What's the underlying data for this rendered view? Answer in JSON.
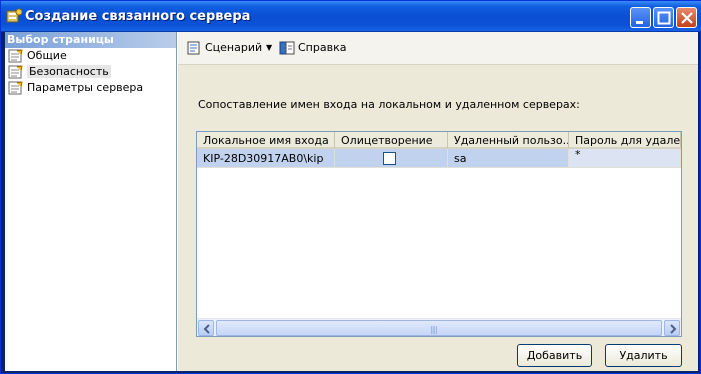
{
  "window": {
    "title": "Создание связанного сервера"
  },
  "sidebar": {
    "header": "Выбор страницы",
    "items": [
      {
        "label": "Общие",
        "selected": false
      },
      {
        "label": "Безопасность",
        "selected": true
      },
      {
        "label": "Параметры сервера",
        "selected": false
      }
    ]
  },
  "toolbar": {
    "script_label": "Сценарий",
    "help_label": "Справка"
  },
  "main": {
    "caption": "Сопоставление имен входа на локальном и удаленном серверах:",
    "grid": {
      "columns": [
        "Локальное имя входа",
        "Олицетворение",
        "Удаленный пользо...",
        "Пароль для удален"
      ],
      "rows": [
        {
          "local_login": "KIP-28D30917AB0\\kip",
          "impersonate": false,
          "remote_user": "sa",
          "password": "*"
        }
      ]
    },
    "add_label": "Добавить",
    "remove_label": "Удалить"
  }
}
